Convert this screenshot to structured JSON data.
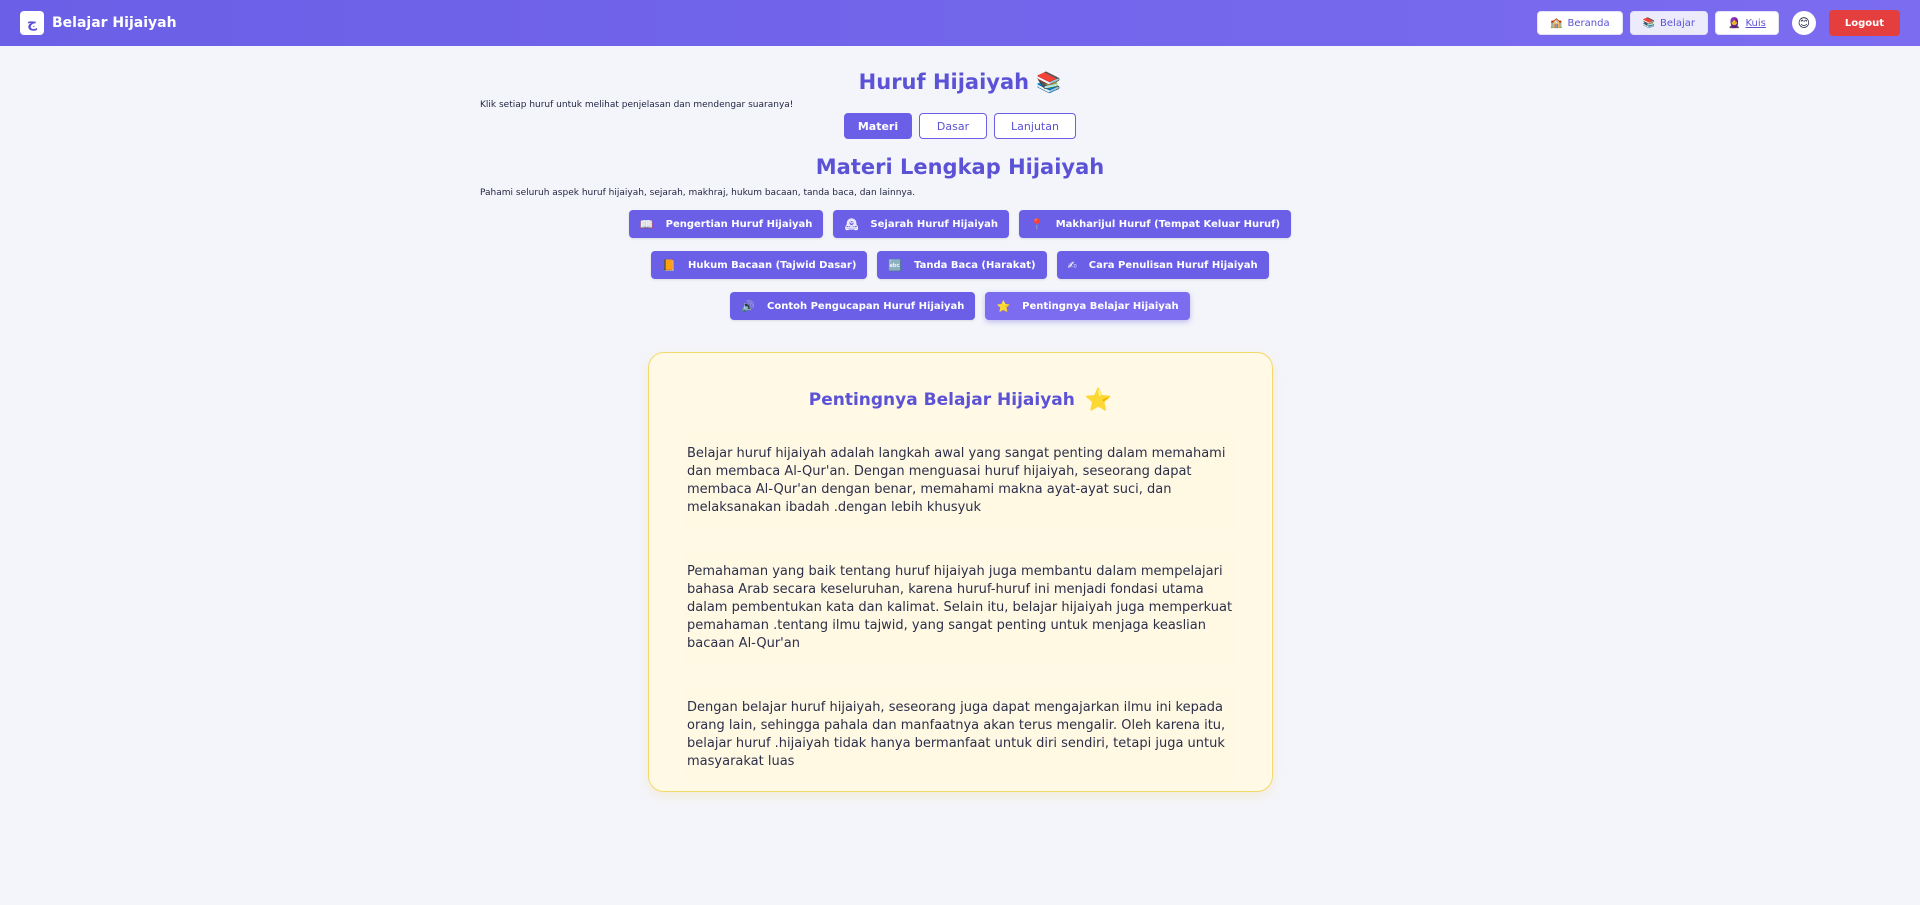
{
  "nav": {
    "logo_glyph": "ج",
    "brand": "Belajar Hijaiyah",
    "links": [
      {
        "icon": "🏫",
        "label": "Beranda"
      },
      {
        "icon": "📚",
        "label": "Belajar"
      },
      {
        "icon": "🧕",
        "label": "Kuis"
      }
    ],
    "avatar": "😊",
    "logout": "Logout"
  },
  "header": {
    "title": "Huruf Hijaiyah",
    "title_icon": "📚",
    "subtitle": "Klik setiap huruf untuk melihat penjelasan dan mendengar suaranya!"
  },
  "tabs": [
    "Materi",
    "Dasar",
    "Lanjutan"
  ],
  "section": {
    "title": "Materi Lengkap Hijaiyah",
    "subtitle": "Pahami seluruh aspek huruf hijaiyah, sejarah, makhraj, hukum bacaan, tanda baca, dan lainnya."
  },
  "topics": [
    {
      "icon": "📖",
      "label": "Pengertian Huruf Hijaiyah"
    },
    {
      "icon": "🕰",
      "label": "Sejarah Huruf Hijaiyah"
    },
    {
      "icon": "📍",
      "label": "Makharijul Huruf (Tempat Keluar Huruf)"
    },
    {
      "icon": "📙",
      "label": "Hukum Bacaan (Tajwid Dasar)"
    },
    {
      "icon": "🔤",
      "label": "Tanda Baca (Harakat)"
    },
    {
      "icon": "✍",
      "label": "Cara Penulisan Huruf Hijaiyah"
    },
    {
      "icon": "🔊",
      "label": "Contoh Pengucapan Huruf Hijaiyah"
    },
    {
      "icon": "⭐",
      "label": "Pentingnya Belajar Hijaiyah"
    }
  ],
  "card": {
    "title": "Pentingnya Belajar Hijaiyah",
    "title_icon": "⭐",
    "paragraphs": [
      "Belajar huruf hijaiyah adalah langkah awal yang sangat penting dalam memahami dan membaca Al-Qur'an. Dengan menguasai huruf hijaiyah, seseorang dapat membaca Al-Qur'an dengan benar, memahami makna ayat-ayat suci, dan melaksanakan ibadah .dengan lebih khusyuk",
      "Pemahaman yang baik tentang huruf hijaiyah juga membantu dalam mempelajari bahasa Arab secara keseluruhan, karena huruf-huruf ini menjadi fondasi utama dalam pembentukan kata dan kalimat. Selain itu, belajar hijaiyah juga memperkuat pemahaman .tentang ilmu tajwid, yang sangat penting untuk menjaga keaslian bacaan Al-Qur'an",
      "Dengan belajar huruf hijaiyah, seseorang juga dapat mengajarkan ilmu ini kepada orang lain, sehingga pahala dan manfaatnya akan terus mengalir. Oleh karena itu, belajar huruf .hijaiyah tidak hanya bermanfaat untuk diri sendiri, tetapi juga untuk masyarakat luas"
    ]
  }
}
